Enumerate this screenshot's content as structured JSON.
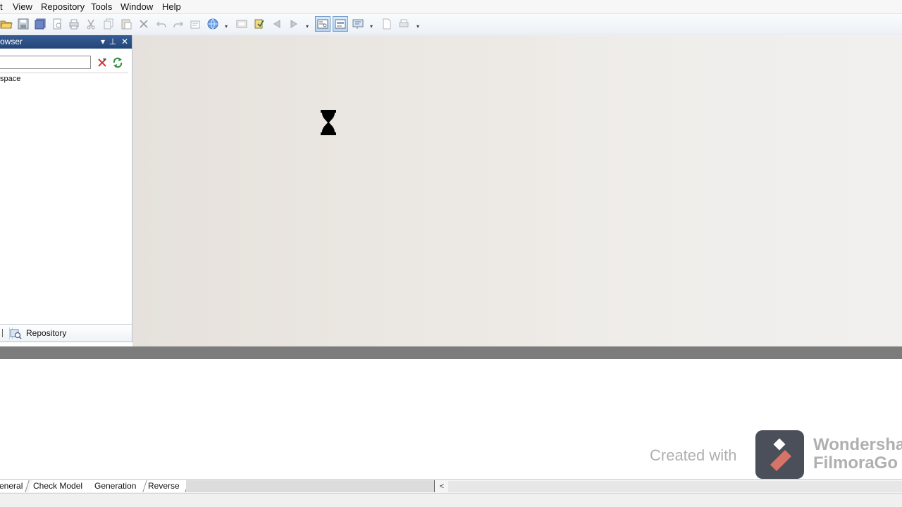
{
  "menu": {
    "items": [
      {
        "label": "t"
      },
      {
        "label": "View"
      },
      {
        "label": "Repository"
      },
      {
        "label": "Tools"
      },
      {
        "label": "Window"
      },
      {
        "label": "Help"
      }
    ]
  },
  "toolbar": {
    "icons": [
      "open-folder-icon",
      "save-icon",
      "save-all-icon",
      "print-preview-icon",
      "print-icon",
      "cut-icon",
      "copy-icon",
      "paste-icon",
      "delete-icon",
      "undo-icon",
      "redo-icon",
      "properties-icon",
      "globe-icon",
      "overflow-icon",
      "repository-browse-icon",
      "check-in-icon",
      "back-icon",
      "forward-icon",
      "overflow-icon",
      "browser-toggle-icon",
      "output-toggle-icon",
      "result-list-icon",
      "overflow-icon",
      "document-icon",
      "printer-icon",
      "overflow-icon"
    ],
    "active_toggles": [
      "browser-toggle-icon",
      "output-toggle-icon"
    ]
  },
  "browser": {
    "title": "owser",
    "search": {
      "value": "",
      "placeholder": ""
    },
    "tree": {
      "items": [
        {
          "label": "space"
        }
      ]
    },
    "bottom_tab": {
      "label": "Repository"
    }
  },
  "cursor": {
    "icon": "hourglass-icon"
  },
  "output": {
    "watermark": {
      "created_with": "Created with",
      "brand": "Wondersha\nFilmoraGo"
    },
    "tabs": [
      {
        "label": "eneral"
      },
      {
        "label": "Check Model"
      },
      {
        "label": "Generation"
      },
      {
        "label": "Reverse"
      }
    ],
    "scroll_left": "<"
  },
  "colors": {
    "panel_title_bg": "#2b4f84",
    "workspace_bg": "#ebe7e2",
    "splitter": "#7c7c7c",
    "watermark_logo": "#4b4f5a",
    "watermark_logo_accent": "#d77468"
  }
}
